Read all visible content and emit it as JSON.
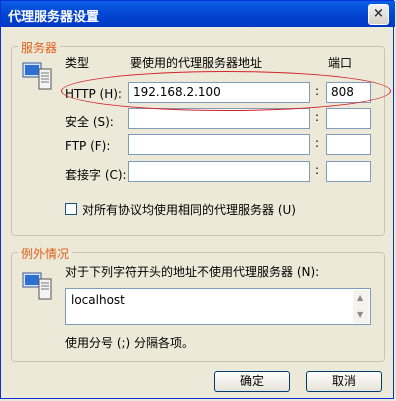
{
  "window": {
    "title": "代理服务器设置",
    "close_glyph": "×"
  },
  "servers": {
    "legend": "服务器",
    "col_type": "类型",
    "col_address": "要使用的代理服务器地址",
    "col_port": "端口",
    "rows": [
      {
        "label": "HTTP (H):",
        "address": "192.168.2.100",
        "port": "808"
      },
      {
        "label": "安全 (S):",
        "address": "",
        "port": ""
      },
      {
        "label": "FTP (F):",
        "address": "",
        "port": ""
      },
      {
        "label": "套接字 (C):",
        "address": "",
        "port": ""
      }
    ],
    "same_proxy_label": "对所有协议均使用相同的代理服务器 (U)"
  },
  "exceptions": {
    "legend": "例外情况",
    "description": "对于下列字符开头的地址不使用代理服务器 (N):",
    "value": "localhost",
    "hint": "使用分号 (;) 分隔各项。"
  },
  "buttons": {
    "ok": "确定",
    "cancel": "取消"
  },
  "colors": {
    "title_bar": "#0347d3",
    "group_legend": "#e0601a",
    "highlight_ellipse": "#d2232a"
  }
}
